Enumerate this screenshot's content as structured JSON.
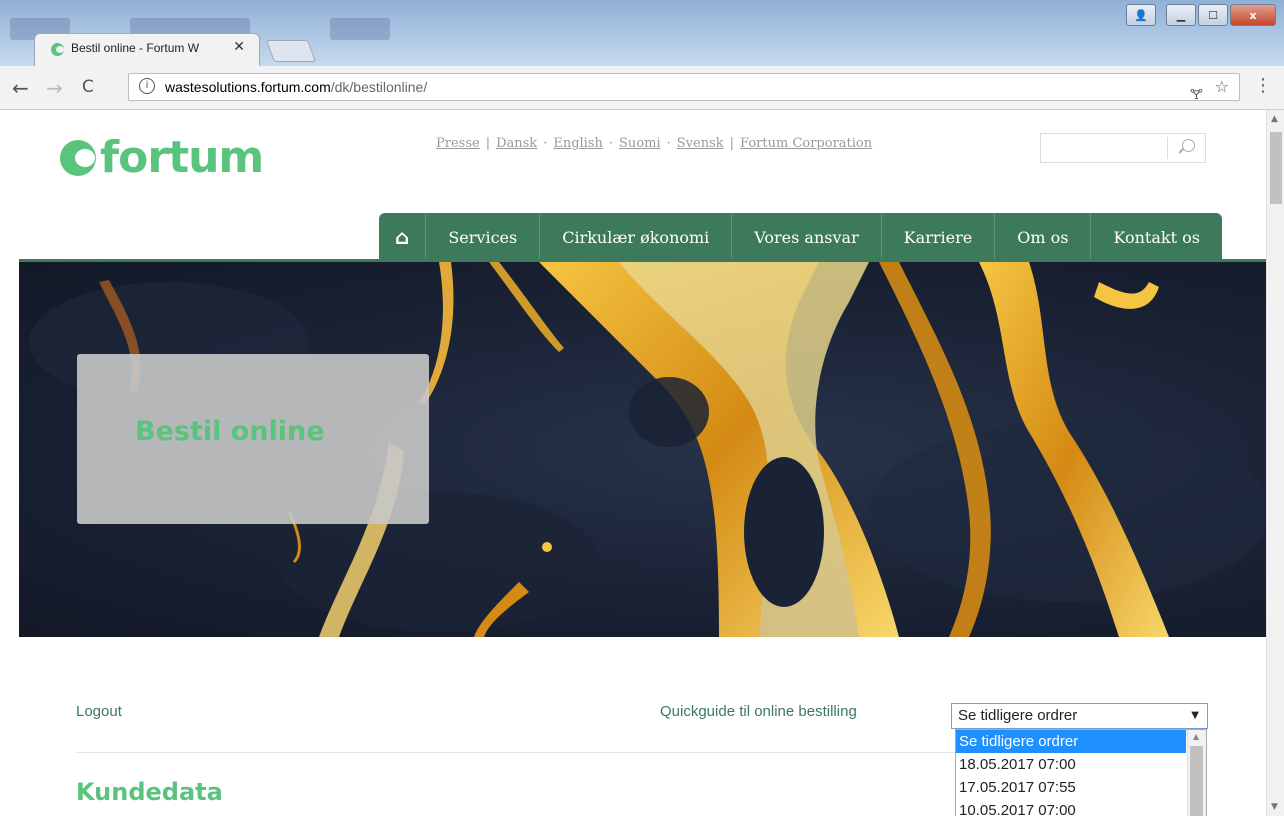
{
  "browser": {
    "tab_title": "Bestil online - Fortum W",
    "tab_close": "✕",
    "url_host": "wastesolutions.fortum.com",
    "url_path": "/dk/bestilonline/",
    "back": "←",
    "forward": "→",
    "reload": "C",
    "info": "i",
    "star": "☆",
    "menu": "⋮",
    "key": "🝖",
    "win_min": "▁",
    "win_max": "☐",
    "win_close": "x",
    "win_user": "👤"
  },
  "header": {
    "logo_text": "fortum",
    "links": [
      "Presse",
      "Dansk",
      "English",
      "Suomi",
      "Svensk",
      "Fortum Corporation"
    ],
    "seps": [
      "|",
      "·",
      "·",
      "·",
      "|"
    ],
    "search_placeholder": ""
  },
  "nav": {
    "home_icon": "⌂",
    "items": [
      "Services",
      "Cirkulær økonomi",
      "Vores ansvar",
      "Karriere",
      "Om os",
      "Kontakt os"
    ]
  },
  "hero": {
    "title": "Bestil online"
  },
  "content": {
    "logout": "Logout",
    "quickguide": "Quickguide til online bestilling",
    "select_value": "Se tidligere ordrer",
    "section_title": "Kundedata",
    "dropdown_options": [
      "Se tidligere ordrer",
      "18.05.2017 07:00",
      "17.05.2017 07:55",
      "10.05.2017 07:00"
    ]
  },
  "colors": {
    "brand_green": "#5ac37d",
    "nav_green": "#3c7a5b",
    "selection_blue": "#1e90ff"
  }
}
